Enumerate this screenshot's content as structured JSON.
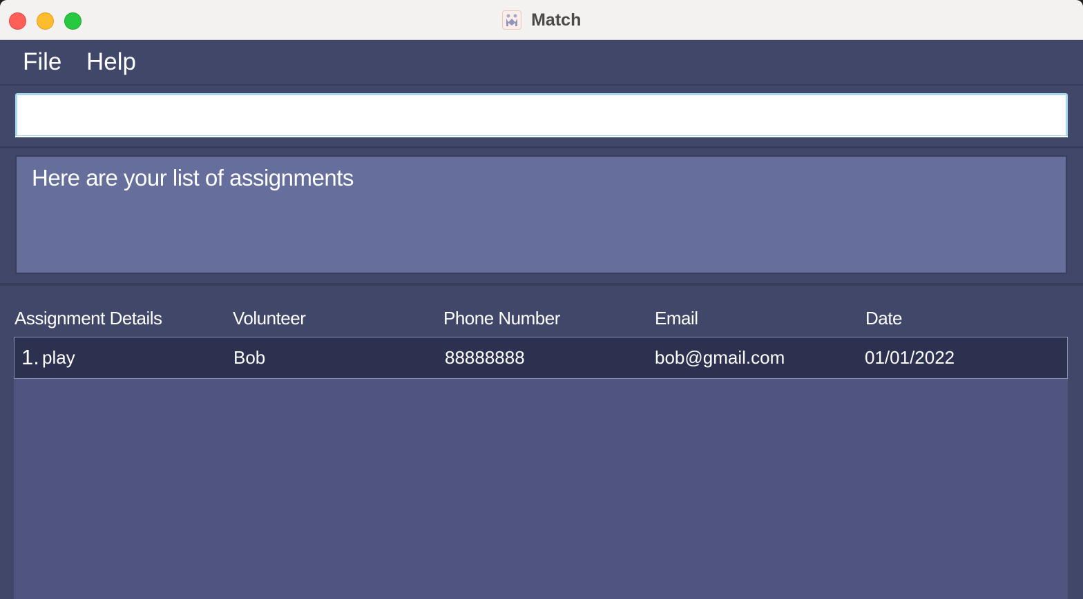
{
  "window": {
    "title": "Match",
    "icon": "match-app-icon"
  },
  "menu": {
    "file_label": "File",
    "help_label": "Help"
  },
  "command": {
    "value": "",
    "placeholder": ""
  },
  "result": {
    "message": "Here are your list of assignments"
  },
  "table": {
    "columns": [
      "Assignment Details",
      "Volunteer",
      "Phone Number",
      "Email",
      "Date"
    ],
    "rows": [
      {
        "index": "1.",
        "details": "play",
        "volunteer": "Bob",
        "phone": "88888888",
        "email": "bob@gmail.com",
        "date": "01/01/2022"
      }
    ]
  },
  "colors": {
    "background": "#414769",
    "result_box": "#666e9c",
    "list_body": "#4f557f",
    "selected_row": "#2d3150",
    "close": "#fe5f57",
    "minimize": "#febc2e",
    "maximize": "#28c840"
  }
}
